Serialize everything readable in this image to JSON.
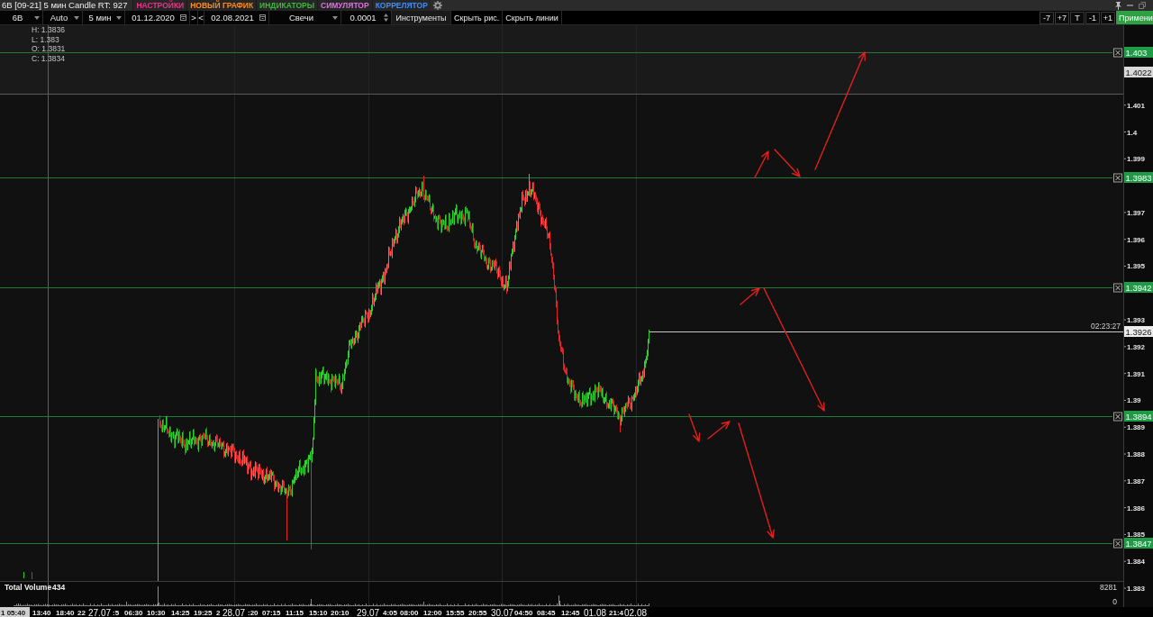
{
  "window": {
    "title": "6B [09-21] 5 мин Candle RT: 927"
  },
  "menu": [
    {
      "label": "НАСТРОЙКИ",
      "color": "#f0308a"
    },
    {
      "label": "НОВЫЙ ГРАФИК",
      "color": "#ff8c1a"
    },
    {
      "label": "ИНДИКАТОРЫ",
      "color": "#30c030"
    },
    {
      "label": "СИМУЛЯТОР",
      "color": "#e070e8"
    },
    {
      "label": "КОРРЕЛЯТОР",
      "color": "#3d8fff"
    }
  ],
  "toolbar": {
    "controls": [
      {
        "kind": "dropdown",
        "value": "6B"
      },
      {
        "kind": "dropdown",
        "value": "Auto"
      },
      {
        "kind": "dropdown",
        "value": "5 мин"
      },
      {
        "kind": "date",
        "value": "01.12.2020"
      },
      {
        "kind": "nav",
        "value": ">"
      },
      {
        "kind": "nav",
        "value": "<"
      },
      {
        "kind": "date",
        "value": "02.08.2021"
      },
      {
        "kind": "dropdown",
        "value": "Свечи"
      },
      {
        "kind": "spinner",
        "value": "0.0001"
      },
      {
        "kind": "button",
        "value": "Инструменты"
      },
      {
        "kind": "button",
        "value": "Скрыть рис."
      },
      {
        "kind": "button",
        "value": "Скрыть линии"
      }
    ],
    "shift_buttons": [
      "-7",
      "+7",
      "T",
      "-1",
      "+1"
    ],
    "apply_button": "Примени"
  },
  "chart": {
    "ohlc": [
      "H: 1.3836",
      "L: 1.383",
      "O: 1.3831",
      "C: 1.3834"
    ],
    "levels": [
      {
        "tag": "1.403"
      },
      {
        "tag": "1.3983"
      },
      {
        "tag": "1.3942"
      },
      {
        "tag": "1.3894"
      },
      {
        "tag": "1.3847"
      }
    ],
    "marker_tag": "1.4022",
    "current_price": {
      "tag": "1.3926",
      "timer": "02:23:27"
    },
    "price_ticks": [
      "1.401",
      "1.4",
      "1.399",
      "1.397",
      "1.396",
      "1.395",
      "1.393",
      "1.392",
      "1.391",
      "1.39",
      "1.389",
      "1.388",
      "1.387",
      "1.386",
      "1.385",
      "1.384",
      "1.383"
    ]
  },
  "volume": {
    "label": "Total Volume",
    "value": "434",
    "scale": [
      "8281",
      "0"
    ]
  },
  "time_axis": {
    "cursor": "1 05:40",
    "labels": [
      {
        "text": "13:40",
        "kind": "time"
      },
      {
        "text": "18:40",
        "kind": "time"
      },
      {
        "text": "22",
        "kind": "time"
      },
      {
        "text": "27.07",
        "kind": "date"
      },
      {
        "text": ":5",
        "kind": "time"
      },
      {
        "text": "06:30",
        "kind": "time"
      },
      {
        "text": "10:30",
        "kind": "time"
      },
      {
        "text": "14:25",
        "kind": "time"
      },
      {
        "text": "19:25",
        "kind": "time"
      },
      {
        "text": "2",
        "kind": "time"
      },
      {
        "text": "28.07",
        "kind": "date"
      },
      {
        "text": ":20",
        "kind": "time"
      },
      {
        "text": "07:15",
        "kind": "time"
      },
      {
        "text": "11:15",
        "kind": "time"
      },
      {
        "text": "15:10",
        "kind": "time"
      },
      {
        "text": "20:10",
        "kind": "time"
      },
      {
        "text": "29.07",
        "kind": "date"
      },
      {
        "text": "4:05",
        "kind": "time"
      },
      {
        "text": "08:00",
        "kind": "time"
      },
      {
        "text": "12:00",
        "kind": "time"
      },
      {
        "text": "15:55",
        "kind": "time"
      },
      {
        "text": "20:55",
        "kind": "time"
      },
      {
        "text": "30.07",
        "kind": "date"
      },
      {
        "text": "04:50",
        "kind": "time"
      },
      {
        "text": "08:45",
        "kind": "time"
      },
      {
        "text": "12:45",
        "kind": "time"
      },
      {
        "text": "01.08",
        "kind": "date"
      },
      {
        "text": "21:4",
        "kind": "time"
      },
      {
        "text": "02.08",
        "kind": "date"
      }
    ]
  }
}
